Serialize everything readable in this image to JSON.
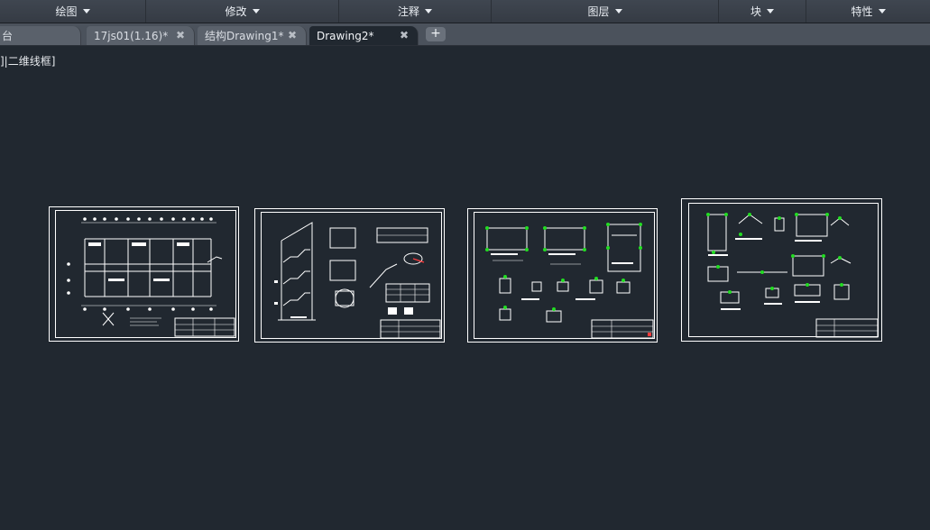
{
  "ribbon": {
    "panels": [
      {
        "label": "绘图"
      },
      {
        "label": "修改"
      },
      {
        "label": "注释"
      },
      {
        "label": "图层"
      },
      {
        "label": "块"
      },
      {
        "label": "特性"
      }
    ]
  },
  "tabs": [
    {
      "label": "台",
      "active": false
    },
    {
      "label": "17js01(1.16)*",
      "active": false
    },
    {
      "label": "结构Drawing1*",
      "active": false
    },
    {
      "label": "Drawing2*",
      "active": true
    }
  ],
  "new_tab_symbol": "+",
  "close_symbol": "✖",
  "viewport": {
    "label": "]|二维线框]"
  },
  "colors": {
    "background": "#212830",
    "linework": "#ffffff",
    "accent_green": "#22dd22",
    "accent_red": "#ff3b3b"
  },
  "sheets": [
    {
      "name": "floor-plan-sheet"
    },
    {
      "name": "stair-section-sheet"
    },
    {
      "name": "detail-sheet-a"
    },
    {
      "name": "detail-sheet-b"
    }
  ]
}
